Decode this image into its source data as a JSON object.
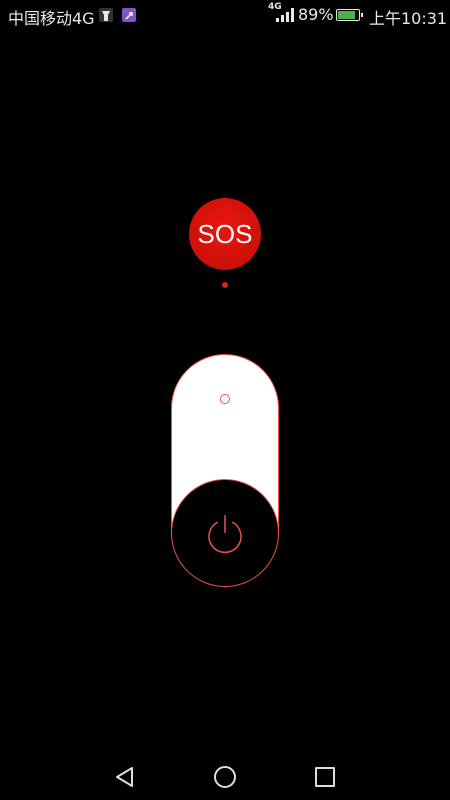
{
  "status_bar": {
    "carrier": "中国移动4G",
    "network_label": "4G",
    "battery_percent": "89%",
    "battery_level": 0.89,
    "time": "上午10:31",
    "icons": [
      "flashlight-notification-icon",
      "app-notification-icon",
      "signal-icon",
      "battery-icon"
    ]
  },
  "sos": {
    "label": "SOS",
    "color": "#e0150d"
  },
  "slider": {
    "accent": "#e8524a",
    "state": "off"
  },
  "nav": {
    "icons": [
      "back-icon",
      "home-icon",
      "recent-apps-icon"
    ]
  }
}
